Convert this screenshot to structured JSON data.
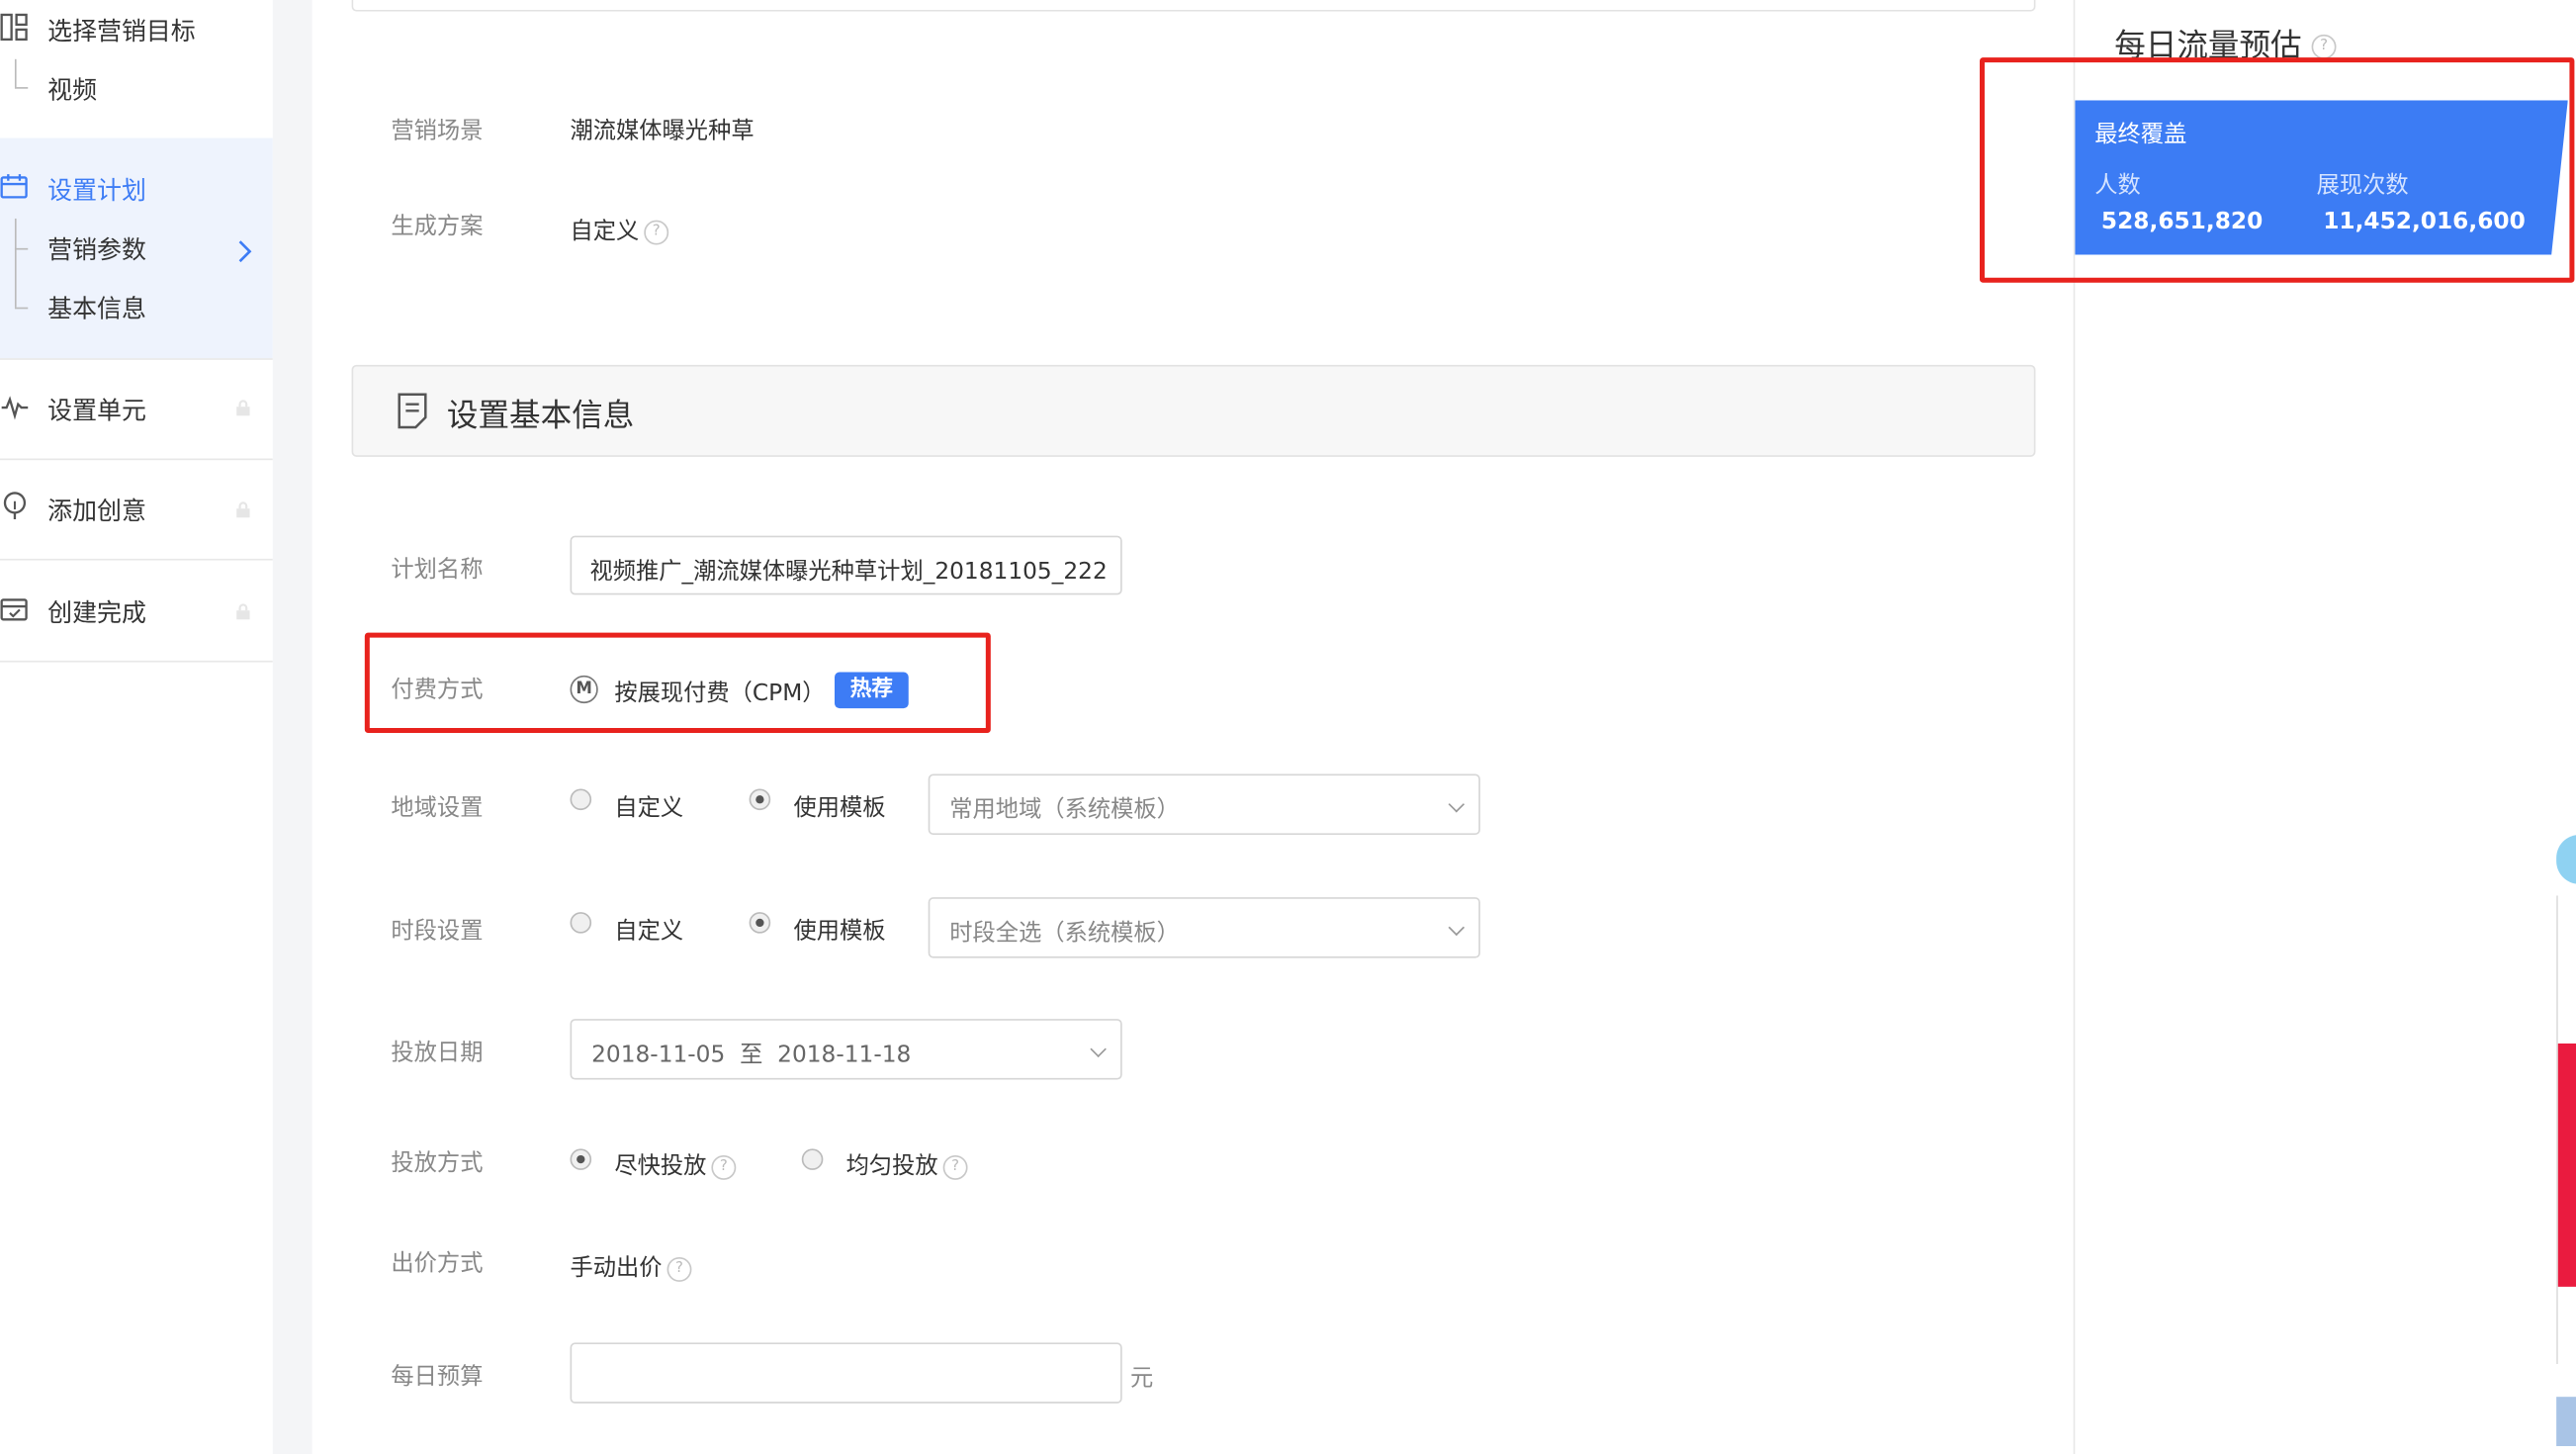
{
  "sidebar": {
    "step1": {
      "label": "选择营销目标",
      "sub": "视频"
    },
    "step2": {
      "label": "设置计划",
      "subs": [
        "营销参数",
        "基本信息"
      ]
    },
    "step3": {
      "label": "设置单元"
    },
    "step4": {
      "label": "添加创意"
    },
    "step5": {
      "label": "创建完成"
    }
  },
  "form": {
    "scene": {
      "label": "营销场景",
      "value": "潮流媒体曝光种草"
    },
    "plan_gen": {
      "label": "生成方案",
      "value": "自定义"
    },
    "section_title": "设置基本信息",
    "plan_name": {
      "label": "计划名称",
      "value": "视频推广_潮流媒体曝光种草计划_20181105_222"
    },
    "payment": {
      "label": "付费方式",
      "icon_letter": "M",
      "option": "按展现付费（CPM）",
      "badge": "热荐"
    },
    "region": {
      "label": "地域设置",
      "option_custom": "自定义",
      "option_template": "使用模板",
      "select": "常用地域（系统模板）"
    },
    "time": {
      "label": "时段设置",
      "option_custom": "自定义",
      "option_template": "使用模板",
      "select": "时段全选（系统模板）"
    },
    "date": {
      "label": "投放日期",
      "start": "2018-11-05",
      "sep": "至",
      "end": "2018-11-18"
    },
    "delivery": {
      "label": "投放方式",
      "option_fast": "尽快投放",
      "option_even": "均匀投放"
    },
    "bid": {
      "label": "出价方式",
      "value": "手动出价"
    },
    "budget": {
      "label": "每日预算",
      "value": "",
      "unit": "元"
    }
  },
  "estimate": {
    "title": "每日流量预估",
    "card_title": "最终覆盖",
    "people_label": "人数",
    "people_value": "528,651,820",
    "views_label": "展现次数",
    "views_value": "11,452,016,600"
  },
  "colors": {
    "accent": "#3d7cf5",
    "card_bg": "#3c7cf4",
    "highlight": "#e8221d",
    "active_step_bg": "#eef3fd"
  }
}
